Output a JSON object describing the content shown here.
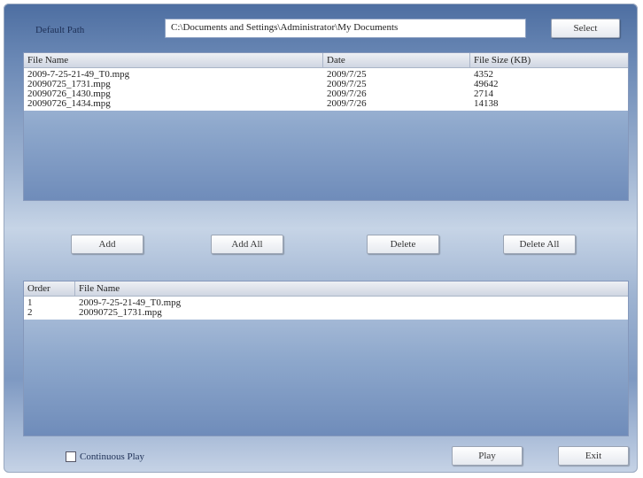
{
  "path_label": "Default Path",
  "path_value": "C:\\Documents and Settings\\Administrator\\My Documents",
  "select_label": "Select",
  "file_list": {
    "headers": [
      "File Name",
      "Date",
      "File Size (KB)"
    ],
    "rows": [
      [
        "2009-7-25-21-49_T0.mpg",
        "2009/7/25",
        "4352"
      ],
      [
        "20090725_1731.mpg",
        "2009/7/25",
        "49642"
      ],
      [
        "20090726_1430.mpg",
        "2009/7/26",
        "2714"
      ],
      [
        "20090726_1434.mpg",
        "2009/7/26",
        "14138"
      ]
    ]
  },
  "actions": {
    "add": "Add",
    "add_all": "Add All",
    "delete": "Delete",
    "delete_all": "Delete All"
  },
  "play_list": {
    "headers": [
      "Order",
      "File Name"
    ],
    "rows": [
      [
        "1",
        "2009-7-25-21-49_T0.mpg"
      ],
      [
        "2",
        "20090725_1731.mpg"
      ]
    ]
  },
  "continuous_play_label": "Continuous Play",
  "play_label": "Play",
  "exit_label": "Exit"
}
